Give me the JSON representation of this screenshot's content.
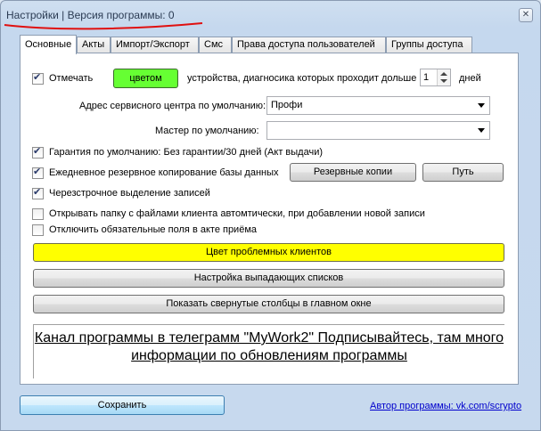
{
  "window": {
    "title": "Настройки | Версия программы: 0",
    "close_label": "✕"
  },
  "tabs": [
    {
      "label": "Основные",
      "active": true
    },
    {
      "label": "Акты"
    },
    {
      "label": "Импорт/Экспорт"
    },
    {
      "label": "Смс"
    },
    {
      "label": "Права доступа пользователей"
    },
    {
      "label": "Группы доступа"
    }
  ],
  "mark": {
    "checked": true,
    "label_before": "Отмечать",
    "color_button": "цветом",
    "label_after": "устройства, диагносика которых проходит дольше",
    "days_value": "1",
    "days_label": "дней"
  },
  "service_center": {
    "label": "Адрес сервисного центра по умолчанию:",
    "value": "Профи"
  },
  "master": {
    "label": "Мастер по умолчанию:",
    "value": ""
  },
  "options": [
    {
      "label": "Гарантия по умолчанию: Без гарантии/30 дней (Акт выдачи)",
      "checked": true
    },
    {
      "label": "Ежедневное резервное копирование базы данных",
      "checked": true
    },
    {
      "label": "Черезстрочное выделение записей",
      "checked": true
    },
    {
      "label": "Открывать папку с файлами клиента автомтически, при добавлении новой записи",
      "checked": false
    },
    {
      "label": "Отключить обязательные поля в акте приёма",
      "checked": false
    }
  ],
  "backup_buttons": {
    "backups": "Резервные копии",
    "path": "Путь"
  },
  "wide_buttons": {
    "problem_clients": "Цвет проблемных клиентов",
    "dropdowns": "Настройка выпадающих списков",
    "hidden_columns": "Показать свернутые столбцы в главном окне"
  },
  "telegram_text": "Канал программы в телеграмм \"MyWork2\" Подписывайтесь, там много информации по обновлениям программы",
  "footer": {
    "save": "Сохранить",
    "author_link": "Автор программы: vk.com/scrypto"
  },
  "colors": {
    "accent_yellow": "#ffff00",
    "accent_green": "#66ff33",
    "underline_red": "#e01010"
  }
}
